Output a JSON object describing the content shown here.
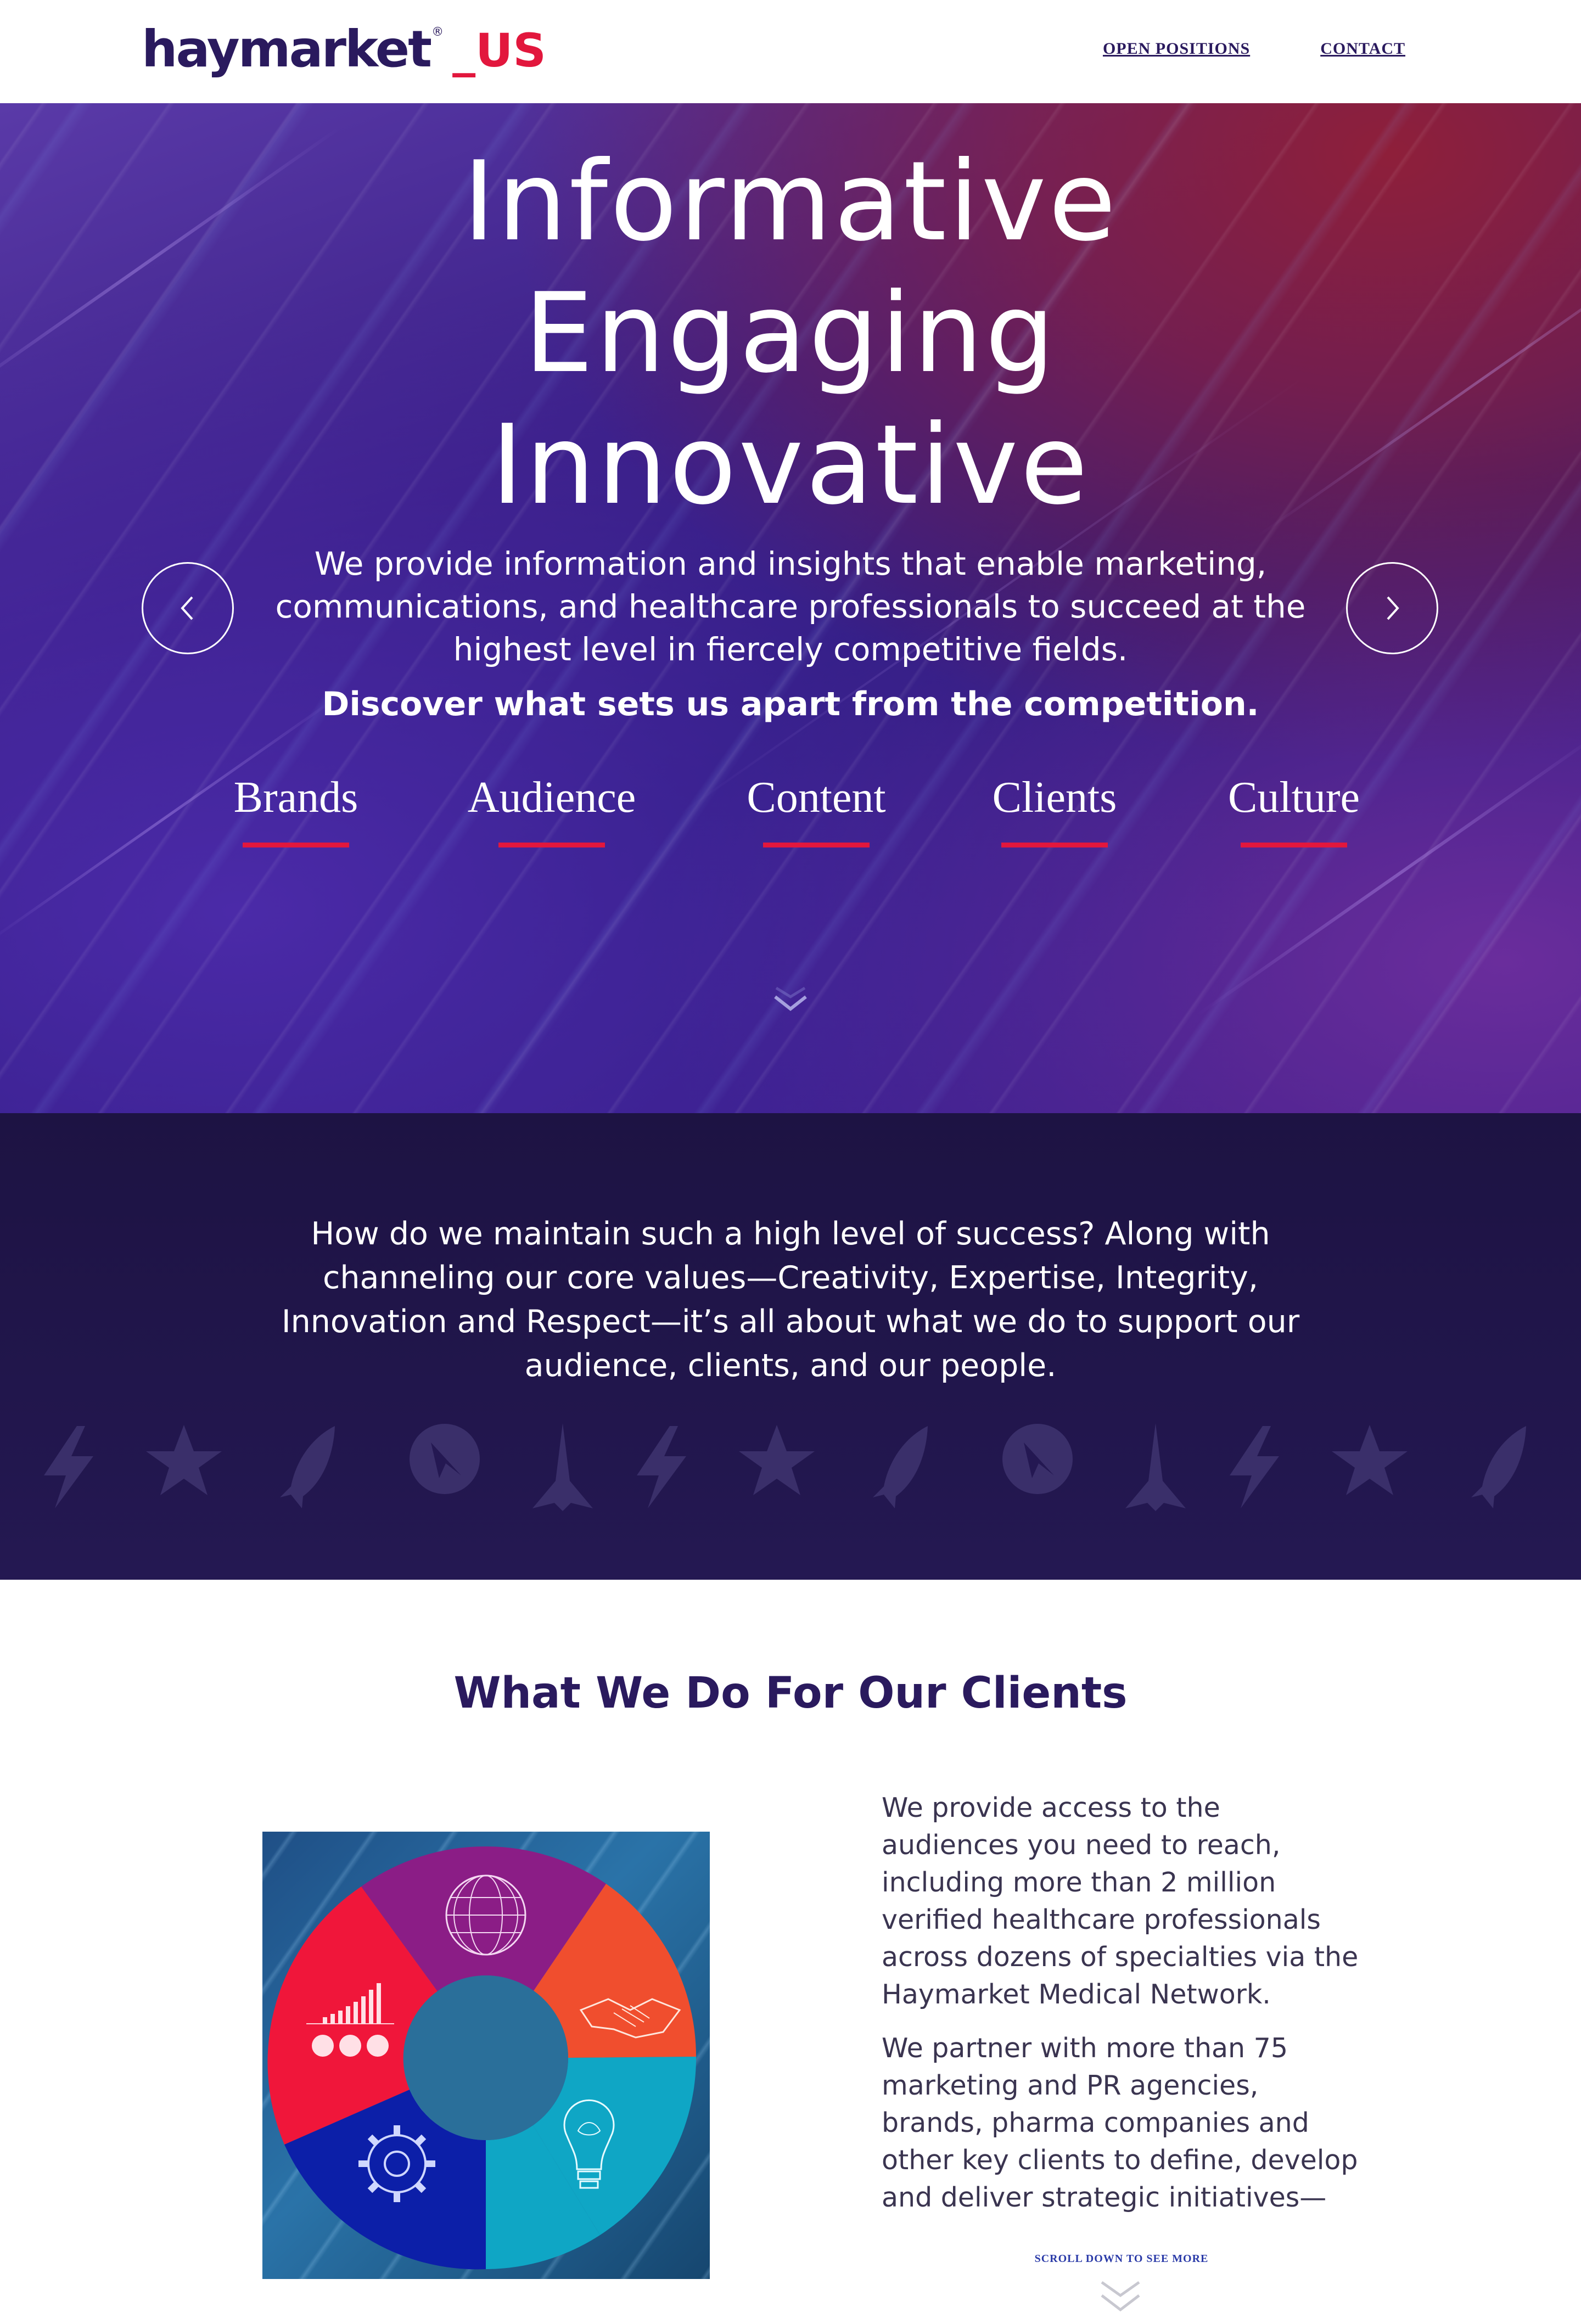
{
  "header": {
    "logo_main": "haymarket",
    "logo_reg": "®",
    "logo_suffix": "_US",
    "nav": [
      {
        "label": "OPEN POSITIONS"
      },
      {
        "label": "CONTACT"
      }
    ]
  },
  "hero": {
    "headline": [
      "Informative",
      "Engaging",
      "Innovative"
    ],
    "description": "We provide information and insights that enable marketing, communications, and healthcare professionals to succeed at the highest level in fiercely competitive fields.",
    "cta": "Discover what sets us apart from the competition.",
    "tabs": [
      {
        "label": "Brands"
      },
      {
        "label": "Audience"
      },
      {
        "label": "Content"
      },
      {
        "label": "Clients"
      },
      {
        "label": "Culture"
      }
    ],
    "icons": {
      "prev": "chevron-left-icon",
      "next": "chevron-right-icon",
      "scroll": "chevron-down-icon"
    }
  },
  "values": {
    "text": "How do we maintain such a high level of success? Along with channeling our core values—Creativity, Expertise, Integrity, Innovation and Respect—it’s all about what we do to support our audience, clients, and our people.",
    "icons": [
      "lightning-icon",
      "star-icon",
      "rocket-icon",
      "compass-icon",
      "spire-icon"
    ]
  },
  "clients": {
    "title": "What We Do For Our Clients",
    "paragraphs": [
      "We provide access to the audiences you need to reach, including more than 2 million verified healthcare professionals across dozens of specialties via the Haymarket Medical Network.",
      "We partner with more than 75 marketing and PR agencies, brands, pharma companies and other key clients to define, develop and deliver strategic initiatives—"
    ],
    "wheel_icons": [
      "globe-icon",
      "handshake-icon",
      "lightbulb-icon",
      "gear-icon",
      "bar-chart-icon"
    ],
    "scroll_more": "SCROLL DOWN TO SEE MORE"
  },
  "colors": {
    "brand_navy": "#2a1a5e",
    "brand_red": "#e2173d",
    "band_dark": "#1d1343"
  }
}
